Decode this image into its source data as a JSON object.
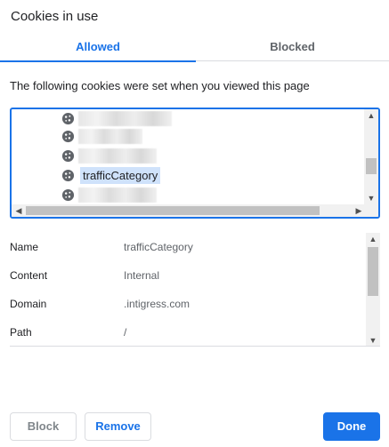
{
  "dialog": {
    "title": "Cookies in use"
  },
  "tabs": [
    {
      "label": "Allowed",
      "selected": true
    },
    {
      "label": "Blocked",
      "selected": false
    }
  ],
  "description": "The following cookies were set when you viewed this page",
  "cookie_tree": {
    "rows": [
      {
        "label": "",
        "obscured": true
      },
      {
        "label": "",
        "obscured": true
      },
      {
        "label": "",
        "obscured": true
      },
      {
        "label": "trafficCategory",
        "obscured": false,
        "selected": true
      },
      {
        "label": "",
        "obscured": true
      }
    ]
  },
  "details": [
    {
      "key": "Name",
      "value": "trafficCategory"
    },
    {
      "key": "Content",
      "value": "Internal"
    },
    {
      "key": "Domain",
      "value": ".intigress.com"
    },
    {
      "key": "Path",
      "value": "/"
    }
  ],
  "buttons": {
    "block": "Block",
    "remove": "Remove",
    "done": "Done"
  },
  "colors": {
    "accent": "#1a73e8",
    "selection": "#cfe2fb"
  },
  "icons": {
    "cookie": "cookie-icon",
    "scroll_up": "scroll-up-arrow-icon",
    "scroll_down": "scroll-down-arrow-icon",
    "scroll_left": "scroll-left-arrow-icon",
    "scroll_right": "scroll-right-arrow-icon"
  }
}
